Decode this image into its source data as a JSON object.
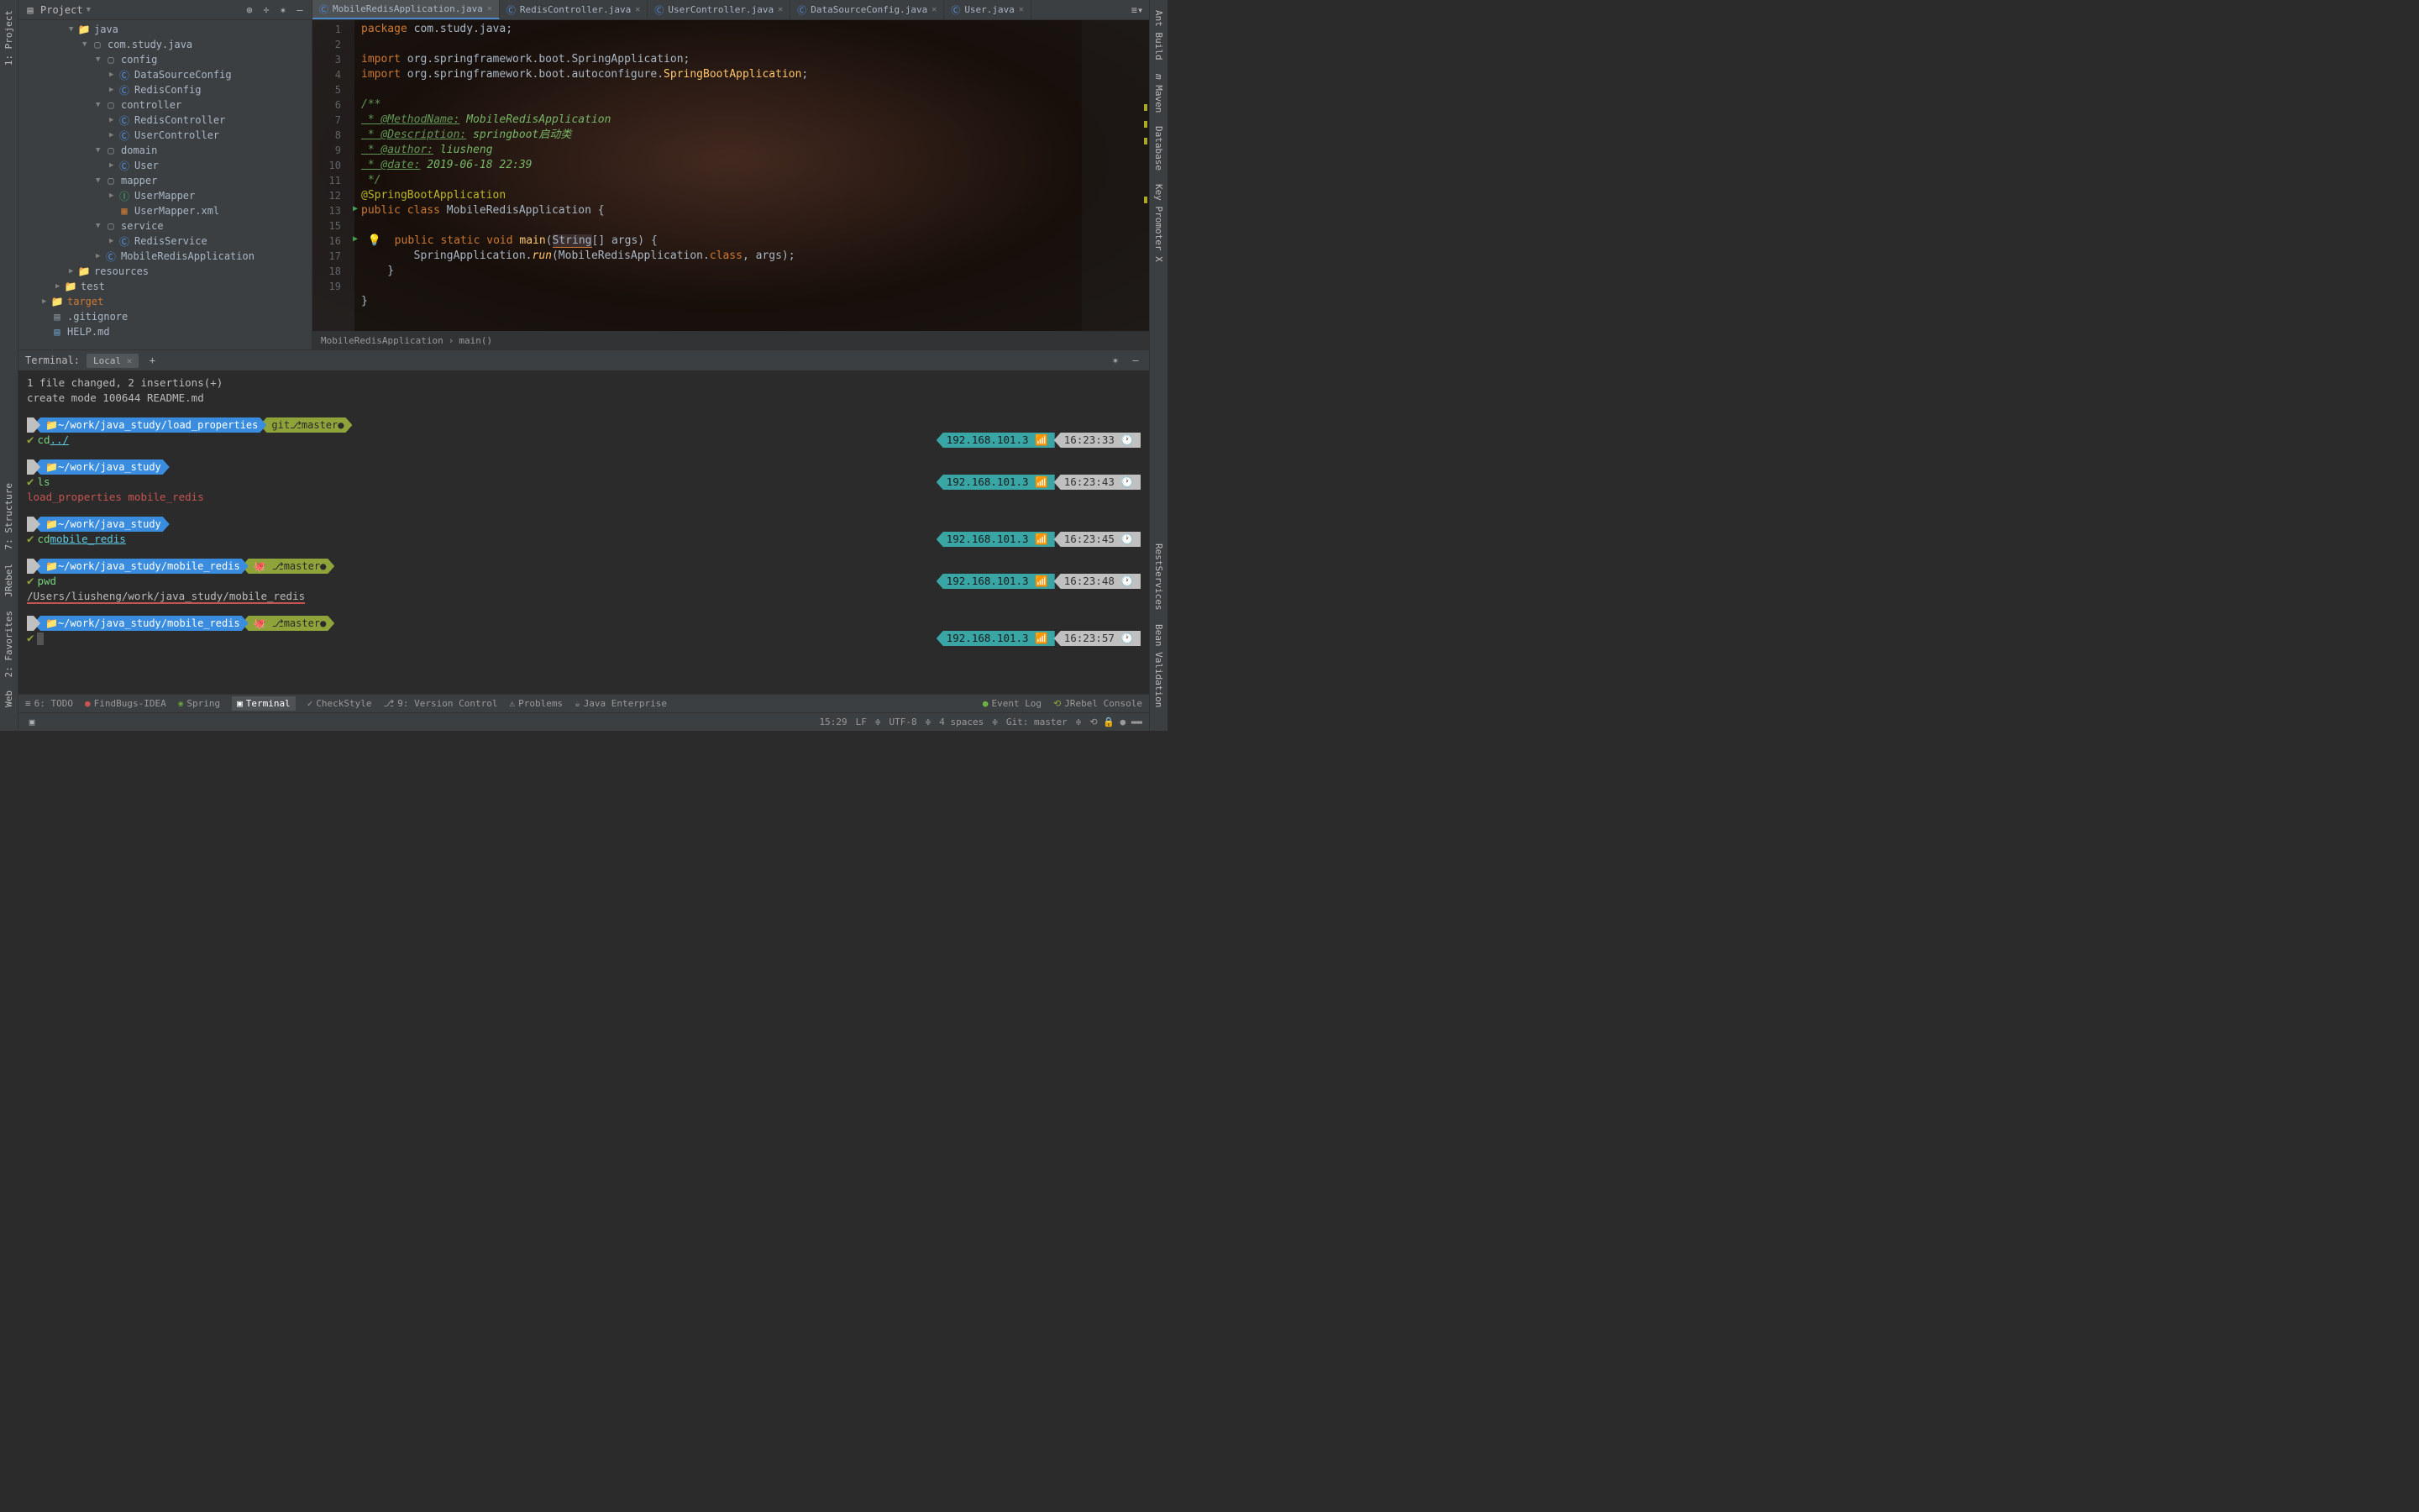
{
  "project": {
    "title": "Project",
    "tree": {
      "java": "java",
      "pkg": "com.study.java",
      "config": "config",
      "dsc": "DataSourceConfig",
      "rc": "RedisConfig",
      "controller": "controller",
      "redisController": "RedisController",
      "userController": "UserController",
      "domain": "domain",
      "user": "User",
      "mapper": "mapper",
      "userMapper": "UserMapper",
      "userMapperXml": "UserMapper.xml",
      "service": "service",
      "redisService": "RedisService",
      "app": "MobileRedisApplication",
      "resources": "resources",
      "test": "test",
      "target": "target",
      "gitignore": ".gitignore",
      "help": "HELP.md"
    }
  },
  "tabs": [
    {
      "label": "MobileRedisApplication.java",
      "active": true
    },
    {
      "label": "RedisController.java",
      "active": false
    },
    {
      "label": "UserController.java",
      "active": false
    },
    {
      "label": "DataSourceConfig.java",
      "active": false
    },
    {
      "label": "User.java",
      "active": false
    }
  ],
  "code": {
    "lines": [
      "1",
      "2",
      "3",
      "4",
      "5",
      "6",
      "7",
      "8",
      "9",
      "10",
      "11",
      "12",
      "13",
      "",
      "15",
      "16",
      "17",
      "18",
      "19"
    ],
    "l1_kw": "package",
    "l1_rest": " com.study.java;",
    "l3_kw": "import",
    "l3_rest": " org.springframework.boot.SpringApplication;",
    "l4_kw": "import",
    "l4_rest": " org.springframework.boot.autoconfigure.",
    "l4_cls": "SpringBootApplication",
    "l4_end": ";",
    "doc_open": "/**",
    "doc_method_tag": " * @MethodName:",
    "doc_method_val": " MobileRedisApplication",
    "doc_desc_tag": " * @Description:",
    "doc_desc_val": " springboot启动类",
    "doc_author_tag": " * @author:",
    "doc_author_val": " liusheng",
    "doc_date_tag": " * @date:",
    "doc_date_val": " 2019-06-18 22:39",
    "doc_close": " */",
    "ann": "@SpringBootApplication",
    "class_decl_kw": "public class ",
    "class_name": "MobileRedisApplication",
    "class_open": " {",
    "main_kw": "public static void ",
    "main_name": "main",
    "main_open": "(",
    "main_type": "String",
    "main_arr": "[] ",
    "main_arg": "args",
    "main_close": ") {",
    "run_line": "        SpringApplication.",
    "run_method": "run",
    "run_open": "(MobileRedisApplication.",
    "run_kw": "class",
    "run_mid": ", args);",
    "brace": "    }",
    "brace2": "}"
  },
  "breadcrumb": {
    "a": "MobileRedisApplication",
    "b": "main()"
  },
  "terminal": {
    "title": "Terminal:",
    "tab": "Local",
    "out1": " 1 file changed, 2 insertions(+)",
    "out2": " create mode 100644 README.md",
    "path1": "~/work/java_study/load_properties",
    "git": "git ",
    "branch": " master",
    "cmd_cd": "cd ",
    "arg_up": "../",
    "ip": "192.168.101.3 ",
    "t1": "16:23:33 ",
    "path2": "~/work/java_study",
    "cmd_ls": "ls",
    "t2": "16:23:43 ",
    "ls_out": "load_properties mobile_redis",
    "arg_mr": "mobile_redis",
    "t3": "16:23:45 ",
    "path3": "~/work/java_study/mobile_redis",
    "cmd_pwd": "pwd",
    "t4": "16:23:48 ",
    "pwd_out": "/Users/liusheng/work/java_study/mobile_redis",
    "t5": "16:23:57 "
  },
  "toolbars": {
    "left": {
      "project": "1: Project",
      "structure": "7: Structure",
      "jrebel": "JRebel",
      "favorites": "2: Favorites",
      "web": "Web"
    },
    "right": {
      "ant": "Ant Build",
      "maven": "Maven",
      "database": "Database",
      "kpx": "Key Promoter X",
      "rest": "RestServices",
      "bean": "Bean Validation"
    }
  },
  "bottom": {
    "todo": "6: TODO",
    "findbugs": "FindBugs-IDEA",
    "spring": "Spring",
    "terminal": "Terminal",
    "checkstyle": "CheckStyle",
    "vcs": "9: Version Control",
    "problems": "Problems",
    "javaee": "Java Enterprise",
    "eventlog": "Event Log",
    "jrebelc": "JRebel Console"
  },
  "status": {
    "pos": "15:29",
    "lf": "LF",
    "enc": "UTF-8",
    "indent": "4 spaces",
    "git": "Git: master"
  }
}
